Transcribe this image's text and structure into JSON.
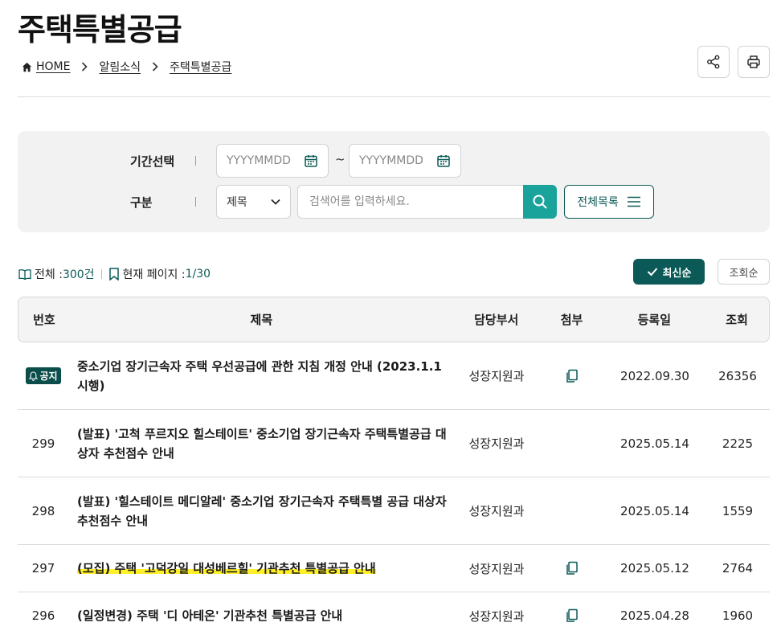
{
  "page": {
    "title": "주택특별공급"
  },
  "breadcrumb": {
    "home": "HOME",
    "level1": "알림소식",
    "level2": "주택특별공급"
  },
  "search": {
    "period_label": "기간선택",
    "start_placeholder": "YYYYMMDD",
    "end_placeholder": "YYYYMMDD",
    "tilde": "~",
    "category_label": "구분",
    "category_selected": "제목",
    "keyword_placeholder": "검색어를 입력하세요.",
    "all_list_label": "전체목록"
  },
  "stats": {
    "total_label": "전체 : ",
    "total_value": "300건",
    "page_label": "현재 페이지 : ",
    "page_value": "1/30"
  },
  "sort": {
    "latest": "최신순",
    "views": "조회순"
  },
  "table": {
    "headers": {
      "no": "번호",
      "title": "제목",
      "dept": "담당부서",
      "attach": "첨부",
      "date": "등록일",
      "views": "조회"
    },
    "notice_badge": "공지",
    "rows": [
      {
        "no": "",
        "title": "중소기업 장기근속자 주택 우선공급에 관한 지침 개정 안내 (2023.1.1 시행)",
        "dept": "성장지원과",
        "date": "2022.09.30",
        "views": "26356"
      },
      {
        "no": "299",
        "title": "(발표) '고척 푸르지오 힐스테이트' 중소기업 장기근속자 주택특별공급 대상자 추천점수 안내",
        "dept": "성장지원과",
        "date": "2025.05.14",
        "views": "2225"
      },
      {
        "no": "298",
        "title": "(발표) '힐스테이트 메디알레' 중소기업 장기근속자 주택특별 공급 대상자 추천점수 안내",
        "dept": "성장지원과",
        "date": "2025.05.14",
        "views": "1559"
      },
      {
        "no": "297",
        "title": "(모집) 주택 '고덕강일 대성베르힐' 기관추천 특별공급 안내",
        "dept": "성장지원과",
        "date": "2025.05.12",
        "views": "2764"
      },
      {
        "no": "296",
        "title": "(일정변경) 주택 '디 아테온' 기관추천 특별공급 안내",
        "dept": "성장지원과",
        "date": "2025.04.28",
        "views": "1960"
      }
    ]
  },
  "colors": {
    "accent": "#0b5a57",
    "search_button": "#1aa39a",
    "highlight": "#fff02a"
  },
  "icons": [
    "home-icon",
    "chevron-right-icon",
    "share-icon",
    "print-icon",
    "calendar-icon",
    "chevron-down-icon",
    "search-icon",
    "menu-icon",
    "book-icon",
    "bookmark-icon",
    "check-icon",
    "bell-icon",
    "file-icon"
  ]
}
